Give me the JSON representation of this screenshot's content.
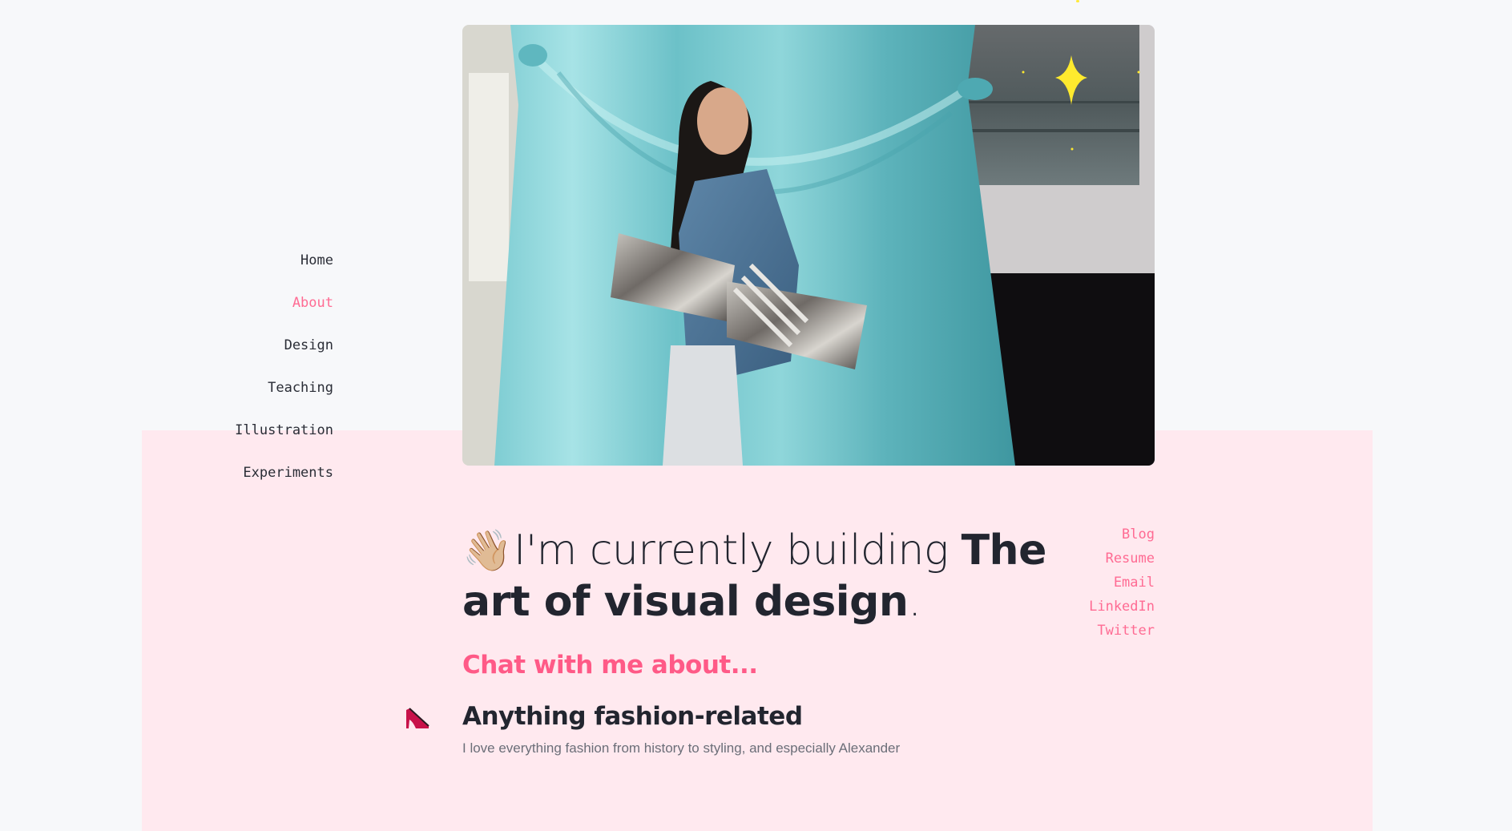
{
  "nav": {
    "items": [
      {
        "label": "Home",
        "active": false
      },
      {
        "label": "About",
        "active": true
      },
      {
        "label": "Design",
        "active": false
      },
      {
        "label": "Teaching",
        "active": false
      },
      {
        "label": "Illustration",
        "active": false
      },
      {
        "label": "Experiments",
        "active": false
      }
    ]
  },
  "hero": {
    "alt": "Portrait of a woman in a denim jacket holding a metallic clutch in front of a teal satin backdrop",
    "sparkle_icon": "sparkle-icon"
  },
  "headline": {
    "emoji": "👋🏼",
    "text_regular": "I'm currently building ",
    "text_bold": "The art of visual design",
    "text_end": "."
  },
  "chat": {
    "title": "Chat with me about..."
  },
  "links": [
    {
      "label": "Blog"
    },
    {
      "label": "Resume"
    },
    {
      "label": "Email"
    },
    {
      "label": "LinkedIn"
    },
    {
      "label": "Twitter"
    }
  ],
  "topics": [
    {
      "icon": "high-heel-icon",
      "title": "Anything fashion-related",
      "description": "I love everything fashion from history to styling, and especially Alexander"
    }
  ],
  "colors": {
    "accent": "#ff6b93",
    "panel": "#ffe9ef",
    "background": "#f7f8fa",
    "text": "#22252f"
  }
}
